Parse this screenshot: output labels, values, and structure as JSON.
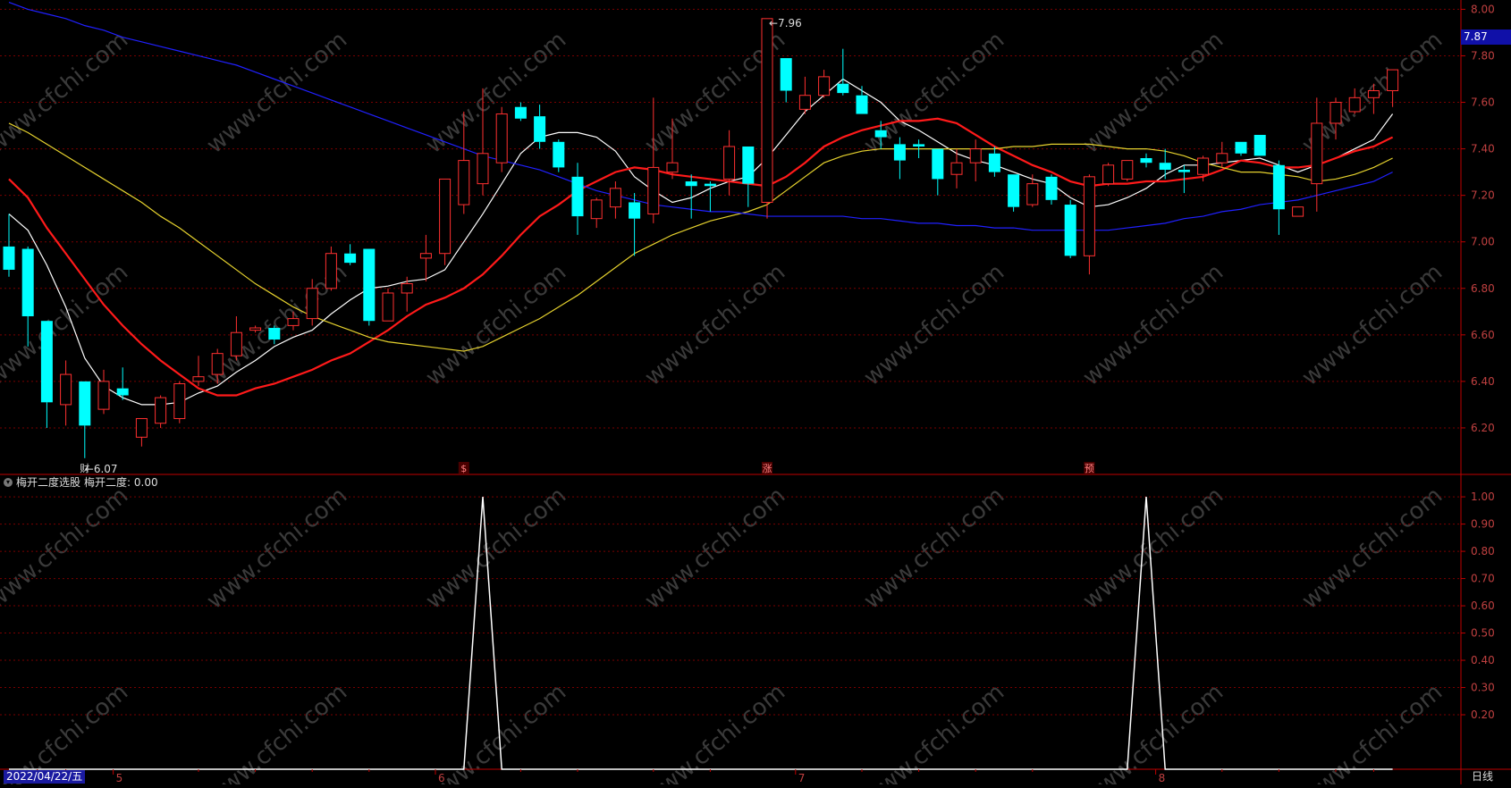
{
  "colors": {
    "up": "#ff3030",
    "down": "#00ffff",
    "ma5": "#ffffff",
    "ma10": "#ff1a1a",
    "ma20": "#e6d22e",
    "ma60": "#2020ff",
    "indicator": "#ffffff",
    "grid": "#7a0000",
    "axis_text": "#c04040",
    "frame": "#c00000"
  },
  "price_badge": "7.87",
  "indicator_title": "梅开二度选股",
  "indicator_value_label": "梅开二度: 0.00",
  "date_label": "2022/04/22/五",
  "period_label": "日线",
  "watermark": "www.cfchi.com",
  "chart_data": [
    {
      "type": "candlestick",
      "y_ticks": [
        "8.00",
        "7.80",
        "7.60",
        "7.40",
        "7.20",
        "7.00",
        "6.80",
        "6.60",
        "6.40",
        "6.20"
      ],
      "ylim": [
        6.0,
        8.04
      ],
      "grid": true,
      "x_tick_labels": [
        "5",
        "6",
        "7",
        "8"
      ],
      "candles": [
        {
          "o": 6.98,
          "h": 7.12,
          "l": 6.85,
          "c": 6.88
        },
        {
          "o": 6.97,
          "h": 6.98,
          "l": 6.55,
          "c": 6.68
        },
        {
          "o": 6.66,
          "h": 6.66,
          "l": 6.2,
          "c": 6.31
        },
        {
          "o": 6.3,
          "h": 6.49,
          "l": 6.21,
          "c": 6.43
        },
        {
          "o": 6.4,
          "h": 6.4,
          "l": 6.07,
          "c": 6.21
        },
        {
          "o": 6.28,
          "h": 6.45,
          "l": 6.26,
          "c": 6.4
        },
        {
          "o": 6.37,
          "h": 6.46,
          "l": 6.32,
          "c": 6.34
        },
        {
          "o": 6.16,
          "h": 6.24,
          "l": 6.12,
          "c": 6.24
        },
        {
          "o": 6.22,
          "h": 6.34,
          "l": 6.2,
          "c": 6.33
        },
        {
          "o": 6.24,
          "h": 6.4,
          "l": 6.22,
          "c": 6.39
        },
        {
          "o": 6.4,
          "h": 6.51,
          "l": 6.38,
          "c": 6.42
        },
        {
          "o": 6.43,
          "h": 6.54,
          "l": 6.39,
          "c": 6.52
        },
        {
          "o": 6.51,
          "h": 6.68,
          "l": 6.49,
          "c": 6.61
        },
        {
          "o": 6.62,
          "h": 6.64,
          "l": 6.61,
          "c": 6.63
        },
        {
          "o": 6.63,
          "h": 6.64,
          "l": 6.56,
          "c": 6.58
        },
        {
          "o": 6.64,
          "h": 6.7,
          "l": 6.62,
          "c": 6.67
        },
        {
          "o": 6.67,
          "h": 6.84,
          "l": 6.64,
          "c": 6.8
        },
        {
          "o": 6.8,
          "h": 6.98,
          "l": 6.79,
          "c": 6.95
        },
        {
          "o": 6.95,
          "h": 6.99,
          "l": 6.9,
          "c": 6.91
        },
        {
          "o": 6.97,
          "h": 6.97,
          "l": 6.64,
          "c": 6.66
        },
        {
          "o": 6.66,
          "h": 6.8,
          "l": 6.66,
          "c": 6.78
        },
        {
          "o": 6.78,
          "h": 6.85,
          "l": 6.7,
          "c": 6.82
        },
        {
          "o": 6.93,
          "h": 7.03,
          "l": 6.83,
          "c": 6.95
        },
        {
          "o": 6.95,
          "h": 7.24,
          "l": 6.9,
          "c": 7.27
        },
        {
          "o": 7.16,
          "h": 7.56,
          "l": 7.12,
          "c": 7.35
        },
        {
          "o": 7.25,
          "h": 7.66,
          "l": 7.2,
          "c": 7.38
        },
        {
          "o": 7.34,
          "h": 7.58,
          "l": 7.3,
          "c": 7.55
        },
        {
          "o": 7.58,
          "h": 7.6,
          "l": 7.52,
          "c": 7.53
        },
        {
          "o": 7.54,
          "h": 7.59,
          "l": 7.4,
          "c": 7.43
        },
        {
          "o": 7.43,
          "h": 7.44,
          "l": 7.3,
          "c": 7.32
        },
        {
          "o": 7.28,
          "h": 7.34,
          "l": 7.03,
          "c": 7.11
        },
        {
          "o": 7.1,
          "h": 7.19,
          "l": 7.06,
          "c": 7.18
        },
        {
          "o": 7.15,
          "h": 7.26,
          "l": 7.1,
          "c": 7.23
        },
        {
          "o": 7.17,
          "h": 7.21,
          "l": 6.94,
          "c": 7.1
        },
        {
          "o": 7.12,
          "h": 7.62,
          "l": 7.08,
          "c": 7.32
        },
        {
          "o": 7.3,
          "h": 7.53,
          "l": 7.27,
          "c": 7.34
        },
        {
          "o": 7.26,
          "h": 7.29,
          "l": 7.1,
          "c": 7.24
        },
        {
          "o": 7.25,
          "h": 7.26,
          "l": 7.13,
          "c": 7.24
        },
        {
          "o": 7.27,
          "h": 7.48,
          "l": 7.2,
          "c": 7.41
        },
        {
          "o": 7.41,
          "h": 7.41,
          "l": 7.15,
          "c": 7.25
        },
        {
          "o": 7.17,
          "h": 7.96,
          "l": 7.1,
          "c": 7.96
        },
        {
          "o": 7.79,
          "h": 7.79,
          "l": 7.6,
          "c": 7.65
        },
        {
          "o": 7.57,
          "h": 7.71,
          "l": 7.55,
          "c": 7.63
        },
        {
          "o": 7.63,
          "h": 7.74,
          "l": 7.62,
          "c": 7.71
        },
        {
          "o": 7.68,
          "h": 7.83,
          "l": 7.63,
          "c": 7.64
        },
        {
          "o": 7.63,
          "h": 7.67,
          "l": 7.55,
          "c": 7.55
        },
        {
          "o": 7.48,
          "h": 7.52,
          "l": 7.4,
          "c": 7.45
        },
        {
          "o": 7.42,
          "h": 7.45,
          "l": 7.27,
          "c": 7.35
        },
        {
          "o": 7.42,
          "h": 7.44,
          "l": 7.36,
          "c": 7.41
        },
        {
          "o": 7.4,
          "h": 7.4,
          "l": 7.2,
          "c": 7.27
        },
        {
          "o": 7.29,
          "h": 7.4,
          "l": 7.23,
          "c": 7.34
        },
        {
          "o": 7.34,
          "h": 7.44,
          "l": 7.26,
          "c": 7.4
        },
        {
          "o": 7.38,
          "h": 7.41,
          "l": 7.28,
          "c": 7.3
        },
        {
          "o": 7.29,
          "h": 7.29,
          "l": 7.13,
          "c": 7.15
        },
        {
          "o": 7.16,
          "h": 7.29,
          "l": 7.15,
          "c": 7.25
        },
        {
          "o": 7.28,
          "h": 7.29,
          "l": 7.16,
          "c": 7.18
        },
        {
          "o": 7.16,
          "h": 7.18,
          "l": 6.93,
          "c": 6.94
        },
        {
          "o": 6.94,
          "h": 7.29,
          "l": 6.86,
          "c": 7.28
        },
        {
          "o": 7.25,
          "h": 7.34,
          "l": 7.24,
          "c": 7.33
        },
        {
          "o": 7.27,
          "h": 7.35,
          "l": 7.26,
          "c": 7.35
        },
        {
          "o": 7.36,
          "h": 7.38,
          "l": 7.32,
          "c": 7.34
        },
        {
          "o": 7.34,
          "h": 7.4,
          "l": 7.27,
          "c": 7.31
        },
        {
          "o": 7.31,
          "h": 7.33,
          "l": 7.21,
          "c": 7.3
        },
        {
          "o": 7.29,
          "h": 7.37,
          "l": 7.26,
          "c": 7.36
        },
        {
          "o": 7.34,
          "h": 7.43,
          "l": 7.32,
          "c": 7.38
        },
        {
          "o": 7.43,
          "h": 7.43,
          "l": 7.37,
          "c": 7.38
        },
        {
          "o": 7.46,
          "h": 7.46,
          "l": 7.37,
          "c": 7.37
        },
        {
          "o": 7.33,
          "h": 7.35,
          "l": 7.03,
          "c": 7.14
        },
        {
          "o": 7.11,
          "h": 7.15,
          "l": 7.11,
          "c": 7.15
        },
        {
          "o": 7.25,
          "h": 7.62,
          "l": 7.13,
          "c": 7.51
        },
        {
          "o": 7.51,
          "h": 7.62,
          "l": 7.44,
          "c": 7.6
        },
        {
          "o": 7.56,
          "h": 7.66,
          "l": 7.55,
          "c": 7.62
        },
        {
          "o": 7.62,
          "h": 7.68,
          "l": 7.55,
          "c": 7.65
        },
        {
          "o": 7.65,
          "h": 7.74,
          "l": 7.58,
          "c": 7.74
        }
      ],
      "series": [
        {
          "color_key": "ma5",
          "values": [
            7.12,
            7.05,
            6.9,
            6.72,
            6.5,
            6.38,
            6.33,
            6.3,
            6.3,
            6.31,
            6.35,
            6.38,
            6.44,
            6.49,
            6.55,
            6.59,
            6.62,
            6.69,
            6.75,
            6.8,
            6.81,
            6.83,
            6.84,
            6.88,
            7.0,
            7.12,
            7.25,
            7.38,
            7.45,
            7.47,
            7.47,
            7.45,
            7.39,
            7.28,
            7.22,
            7.17,
            7.19,
            7.23,
            7.26,
            7.28,
            7.36,
            7.46,
            7.56,
            7.63,
            7.7,
            7.65,
            7.6,
            7.52,
            7.48,
            7.43,
            7.38,
            7.35,
            7.33,
            7.3,
            7.27,
            7.25,
            7.19,
            7.15,
            7.16,
            7.19,
            7.23,
            7.29,
            7.33,
            7.33,
            7.34,
            7.35,
            7.36,
            7.33,
            7.3,
            7.33,
            7.36,
            7.4,
            7.44,
            7.55
          ]
        },
        {
          "color_key": "ma10",
          "values": [
            7.27,
            7.19,
            7.06,
            6.95,
            6.84,
            6.73,
            6.64,
            6.56,
            6.49,
            6.43,
            6.37,
            6.34,
            6.34,
            6.37,
            6.39,
            6.42,
            6.45,
            6.49,
            6.52,
            6.57,
            6.62,
            6.68,
            6.73,
            6.76,
            6.8,
            6.86,
            6.94,
            7.03,
            7.11,
            7.16,
            7.22,
            7.26,
            7.3,
            7.32,
            7.31,
            7.29,
            7.28,
            7.27,
            7.26,
            7.25,
            7.24,
            7.28,
            7.34,
            7.41,
            7.45,
            7.48,
            7.5,
            7.52,
            7.52,
            7.53,
            7.51,
            7.46,
            7.41,
            7.37,
            7.33,
            7.3,
            7.26,
            7.24,
            7.25,
            7.25,
            7.26,
            7.26,
            7.27,
            7.28,
            7.31,
            7.35,
            7.34,
            7.32,
            7.32,
            7.33,
            7.36,
            7.39,
            7.41,
            7.45
          ]
        },
        {
          "color_key": "ma20",
          "values": [
            7.51,
            7.47,
            7.42,
            7.37,
            7.32,
            7.27,
            7.22,
            7.17,
            7.11,
            7.06,
            7.0,
            6.94,
            6.88,
            6.82,
            6.77,
            6.72,
            6.68,
            6.65,
            6.62,
            6.59,
            6.57,
            6.56,
            6.55,
            6.54,
            6.53,
            6.55,
            6.59,
            6.63,
            6.67,
            6.72,
            6.77,
            6.83,
            6.89,
            6.95,
            6.99,
            7.03,
            7.06,
            7.09,
            7.11,
            7.13,
            7.16,
            7.22,
            7.28,
            7.34,
            7.37,
            7.39,
            7.4,
            7.4,
            7.4,
            7.4,
            7.4,
            7.4,
            7.4,
            7.41,
            7.41,
            7.42,
            7.42,
            7.42,
            7.41,
            7.4,
            7.4,
            7.39,
            7.37,
            7.34,
            7.32,
            7.3,
            7.3,
            7.29,
            7.28,
            7.26,
            7.27,
            7.29,
            7.32,
            7.36
          ]
        },
        {
          "color_key": "ma60",
          "values": [
            8.03,
            8.0,
            7.98,
            7.96,
            7.93,
            7.91,
            7.88,
            7.86,
            7.84,
            7.82,
            7.8,
            7.78,
            7.76,
            7.73,
            7.7,
            7.67,
            7.64,
            7.61,
            7.58,
            7.55,
            7.52,
            7.49,
            7.46,
            7.43,
            7.4,
            7.37,
            7.35,
            7.33,
            7.31,
            7.28,
            7.25,
            7.22,
            7.2,
            7.18,
            7.16,
            7.15,
            7.14,
            7.13,
            7.13,
            7.12,
            7.11,
            7.11,
            7.11,
            7.11,
            7.11,
            7.1,
            7.1,
            7.09,
            7.08,
            7.08,
            7.07,
            7.07,
            7.06,
            7.06,
            7.05,
            7.05,
            7.05,
            7.05,
            7.05,
            7.06,
            7.07,
            7.08,
            7.1,
            7.11,
            7.13,
            7.14,
            7.16,
            7.17,
            7.18,
            7.2,
            7.22,
            7.24,
            7.26,
            7.3
          ]
        }
      ],
      "annotations": [
        {
          "label": "6.07",
          "candle_index": 4,
          "price": 6.07,
          "type": "low"
        },
        {
          "label": "7.96",
          "candle_index": 40,
          "price": 7.96,
          "type": "high"
        }
      ],
      "markers": [
        {
          "label": "财",
          "candle_index": 4
        },
        {
          "label": "$",
          "candle_index": 24
        },
        {
          "label": "涨",
          "candle_index": 40
        },
        {
          "label": "预",
          "candle_index": 57
        }
      ]
    },
    {
      "type": "line",
      "title": "梅开二度选股",
      "y_ticks": [
        "1.00",
        "0.90",
        "0.80",
        "0.70",
        "0.60",
        "0.50",
        "0.40",
        "0.30",
        "0.20"
      ],
      "ylim": [
        0,
        1.02
      ],
      "grid": true,
      "series": [
        {
          "name": "梅开二度",
          "values": [
            0,
            0,
            0,
            0,
            0,
            0,
            0,
            0,
            0,
            0,
            0,
            0,
            0,
            0,
            0,
            0,
            0,
            0,
            0,
            0,
            0,
            0,
            0,
            0,
            0,
            1,
            0,
            0,
            0,
            0,
            0,
            0,
            0,
            0,
            0,
            0,
            0,
            0,
            0,
            0,
            0,
            0,
            0,
            0,
            0,
            0,
            0,
            0,
            0,
            0,
            0,
            0,
            0,
            0,
            0,
            0,
            0,
            0,
            0,
            0,
            1,
            0,
            0,
            0,
            0,
            0,
            0,
            0,
            0,
            0,
            0,
            0,
            0,
            0
          ]
        }
      ]
    }
  ]
}
